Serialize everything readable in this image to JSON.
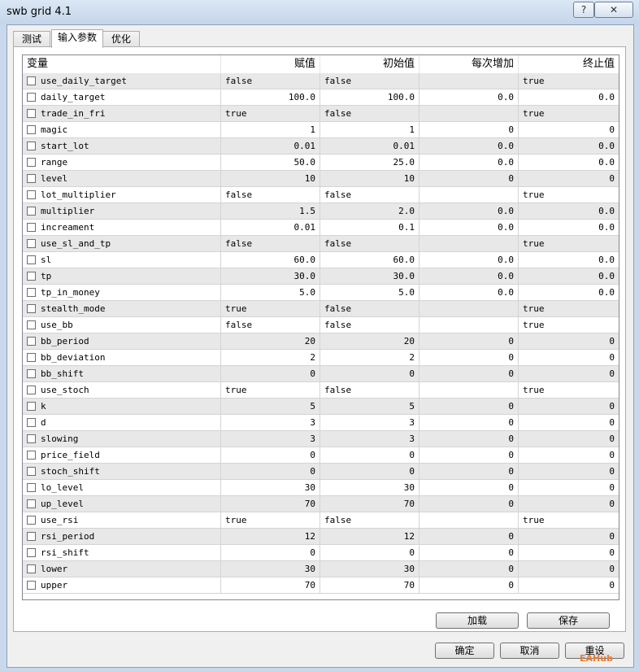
{
  "window": {
    "title": "swb grid 4.1",
    "help_label": "?",
    "close_label": "✕"
  },
  "tabs": [
    {
      "label": "测试"
    },
    {
      "label": "输入参数"
    },
    {
      "label": "优化"
    }
  ],
  "table": {
    "headers": [
      "变量",
      "赋值",
      "初始值",
      "每次增加",
      "终止值"
    ],
    "rows": [
      {
        "name": "use_daily_target",
        "value": "false",
        "start": "false",
        "step": "",
        "stop": "true"
      },
      {
        "name": "daily_target",
        "value": "100.0",
        "start": "100.0",
        "step": "0.0",
        "stop": "0.0"
      },
      {
        "name": "trade_in_fri",
        "value": "true",
        "start": "false",
        "step": "",
        "stop": "true"
      },
      {
        "name": "magic",
        "value": "1",
        "start": "1",
        "step": "0",
        "stop": "0"
      },
      {
        "name": "start_lot",
        "value": "0.01",
        "start": "0.01",
        "step": "0.0",
        "stop": "0.0"
      },
      {
        "name": "range",
        "value": "50.0",
        "start": "25.0",
        "step": "0.0",
        "stop": "0.0"
      },
      {
        "name": "level",
        "value": "10",
        "start": "10",
        "step": "0",
        "stop": "0"
      },
      {
        "name": "lot_multiplier",
        "value": "false",
        "start": "false",
        "step": "",
        "stop": "true"
      },
      {
        "name": "multiplier",
        "value": "1.5",
        "start": "2.0",
        "step": "0.0",
        "stop": "0.0"
      },
      {
        "name": "increament",
        "value": "0.01",
        "start": "0.1",
        "step": "0.0",
        "stop": "0.0"
      },
      {
        "name": "use_sl_and_tp",
        "value": "false",
        "start": "false",
        "step": "",
        "stop": "true"
      },
      {
        "name": "sl",
        "value": "60.0",
        "start": "60.0",
        "step": "0.0",
        "stop": "0.0"
      },
      {
        "name": "tp",
        "value": "30.0",
        "start": "30.0",
        "step": "0.0",
        "stop": "0.0"
      },
      {
        "name": "tp_in_money",
        "value": "5.0",
        "start": "5.0",
        "step": "0.0",
        "stop": "0.0"
      },
      {
        "name": "stealth_mode",
        "value": "true",
        "start": "false",
        "step": "",
        "stop": "true"
      },
      {
        "name": "use_bb",
        "value": "false",
        "start": "false",
        "step": "",
        "stop": "true"
      },
      {
        "name": "bb_period",
        "value": "20",
        "start": "20",
        "step": "0",
        "stop": "0"
      },
      {
        "name": "bb_deviation",
        "value": "2",
        "start": "2",
        "step": "0",
        "stop": "0"
      },
      {
        "name": "bb_shift",
        "value": "0",
        "start": "0",
        "step": "0",
        "stop": "0"
      },
      {
        "name": "use_stoch",
        "value": "true",
        "start": "false",
        "step": "",
        "stop": "true"
      },
      {
        "name": "k",
        "value": "5",
        "start": "5",
        "step": "0",
        "stop": "0"
      },
      {
        "name": "d",
        "value": "3",
        "start": "3",
        "step": "0",
        "stop": "0"
      },
      {
        "name": "slowing",
        "value": "3",
        "start": "3",
        "step": "0",
        "stop": "0"
      },
      {
        "name": "price_field",
        "value": "0",
        "start": "0",
        "step": "0",
        "stop": "0"
      },
      {
        "name": "stoch_shift",
        "value": "0",
        "start": "0",
        "step": "0",
        "stop": "0"
      },
      {
        "name": "lo_level",
        "value": "30",
        "start": "30",
        "step": "0",
        "stop": "0"
      },
      {
        "name": "up_level",
        "value": "70",
        "start": "70",
        "step": "0",
        "stop": "0"
      },
      {
        "name": "use_rsi",
        "value": "true",
        "start": "false",
        "step": "",
        "stop": "true"
      },
      {
        "name": "rsi_period",
        "value": "12",
        "start": "12",
        "step": "0",
        "stop": "0"
      },
      {
        "name": "rsi_shift",
        "value": "0",
        "start": "0",
        "step": "0",
        "stop": "0"
      },
      {
        "name": "lower",
        "value": "30",
        "start": "30",
        "step": "0",
        "stop": "0"
      },
      {
        "name": "upper",
        "value": "70",
        "start": "70",
        "step": "0",
        "stop": "0"
      }
    ]
  },
  "buttons": {
    "load": "加载",
    "save": "保存",
    "ok": "确定",
    "cancel": "取消",
    "reset": "重设"
  },
  "watermark": "EAHub"
}
